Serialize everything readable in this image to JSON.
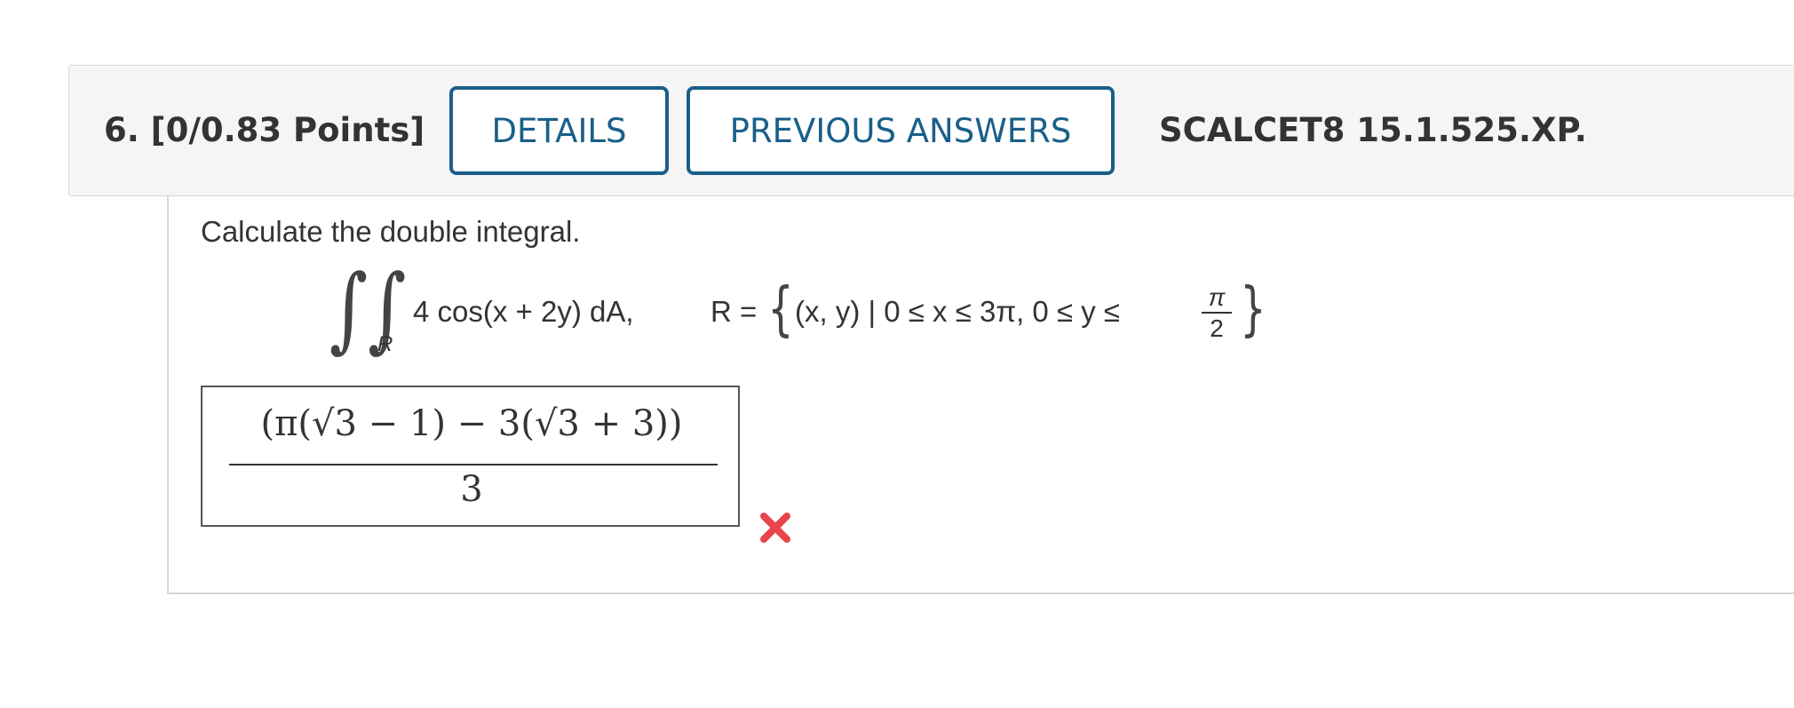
{
  "question": {
    "number_points": "6.  [0/0.83 Points]",
    "details_label": "DETAILS",
    "previous_answers_label": "PREVIOUS ANSWERS",
    "reference": "SCALCET8 15.1.525.XP."
  },
  "problem": {
    "prompt": "Calculate the double integral.",
    "integral_symbol": "∫∫",
    "region_subscript": "R",
    "integrand": "4 cos(x + 2y) dA,",
    "region_lhs": "R =",
    "left_brace": "{",
    "region_set": "(x, y) | 0 ≤ x ≤ 3π, 0 ≤ y ≤",
    "fraction_numerator": "π",
    "fraction_denominator": "2",
    "right_brace": "}"
  },
  "answer": {
    "numerator": "(π(√3 − 1) − 3(√3 + 3))",
    "denominator": "3",
    "status_icon": "wrong-x-icon",
    "status_color": "#e8454c"
  },
  "colors": {
    "accent": "#1a5f8a",
    "header_bg": "#f5f5f5",
    "text": "#333333"
  }
}
